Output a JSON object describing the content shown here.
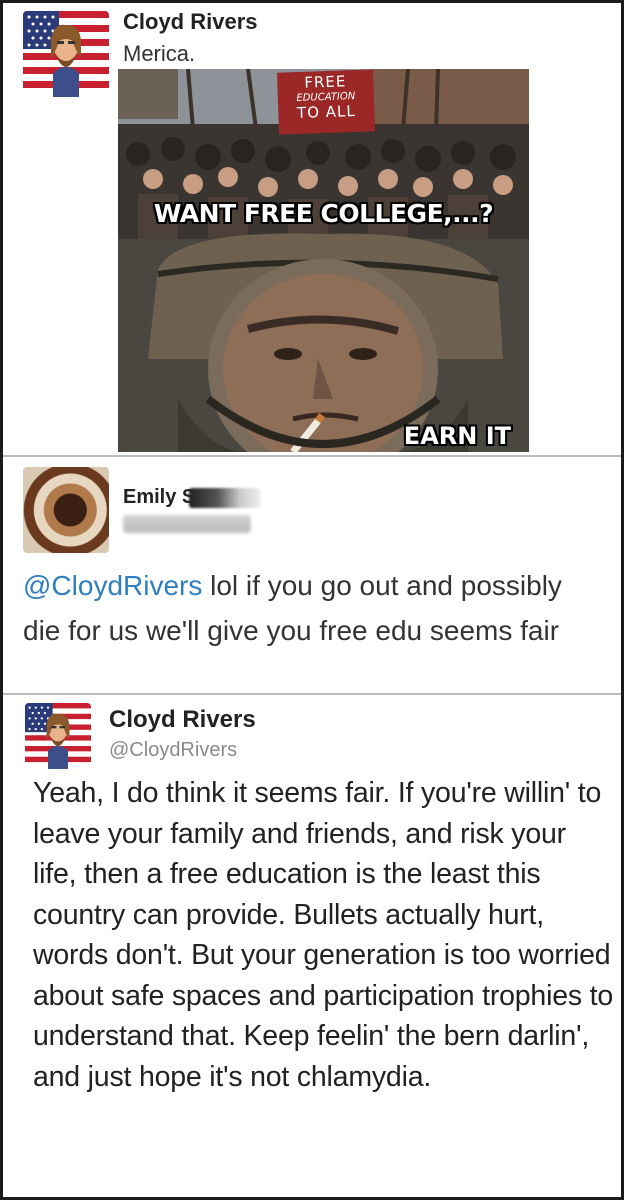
{
  "tweet_original": {
    "author_name": "Cloyd Rivers",
    "text": "Merica.",
    "avatar_icon": "american-flag-bearded-man-avatar",
    "meme": {
      "banner_line1": "FREE",
      "banner_line2": "EDUCATION",
      "banner_line3": "TO ALL",
      "caption_top": "WANT FREE COLLEGE,...?",
      "caption_bottom": "EARN IT"
    }
  },
  "tweet_reply": {
    "author_name": "Emily S",
    "mention": "@CloydRivers",
    "text": " lol if you go out and possibly die for us we'll give you free edu seems fair"
  },
  "tweet_response": {
    "author_name": "Cloyd Rivers",
    "handle": "@CloydRivers",
    "avatar_icon": "american-flag-bearded-man-avatar",
    "text": "Yeah, I do think it seems fair. If you're willin' to leave your family and friends, and risk your life, then a free education is the least this country can provide. Bullets actually hurt, words don't. But your generation is too worried about safe spaces and participation trophies to understand that. Keep feelin' the bern darlin', and just hope it's not chlamydia."
  },
  "colors": {
    "mention": "#2f7fc0",
    "banner": "#9b2727",
    "divider": "#bdbdbd"
  }
}
